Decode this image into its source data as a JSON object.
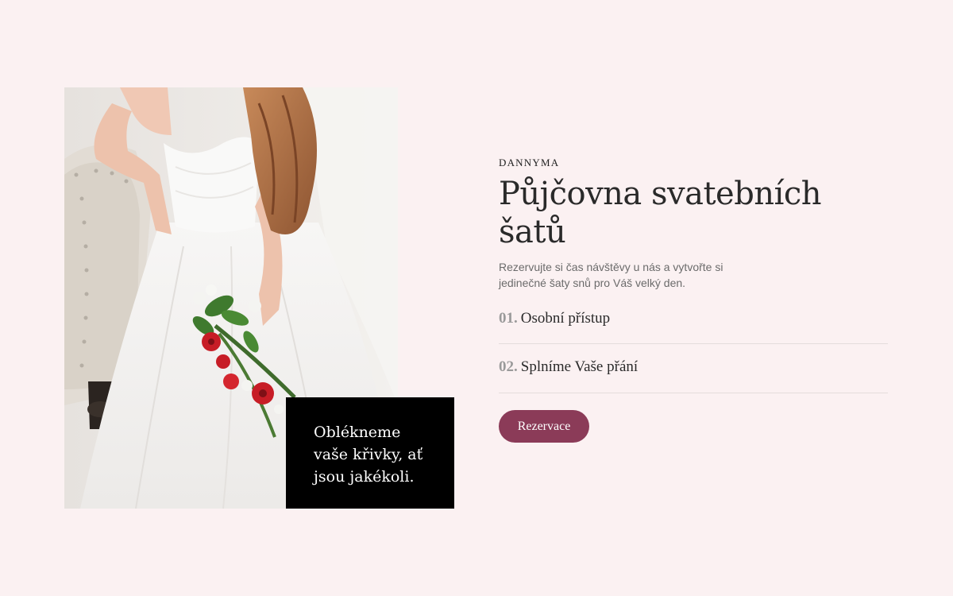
{
  "hero": {
    "quote": "Oblékneme vaše křivky, ať jsou jakékoli.",
    "photo_icon": "bride-photo"
  },
  "content": {
    "brand": "DANNYMA",
    "title": "Půjčovna svatebních šatů",
    "subtitle": "Rezervujte si čas návštěvy u nás a vytvořte si jedinečné šaty snů pro Váš velký den.",
    "features": [
      {
        "number": "01.",
        "label": "Osobní přístup"
      },
      {
        "number": "02.",
        "label": "Splníme Vaše přání"
      }
    ],
    "button_label": "Rezervace"
  },
  "colors": {
    "background": "#fbf1f2",
    "accent": "#8b3b58",
    "quote_box": "#000000"
  }
}
